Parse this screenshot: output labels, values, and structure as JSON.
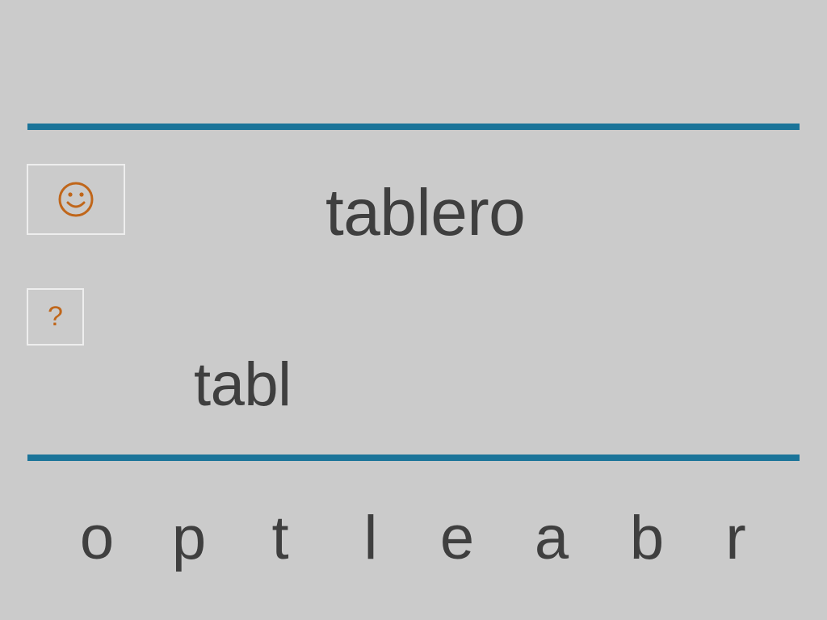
{
  "target_word": "tablero",
  "answer_text": "tabl",
  "hint_label": "?",
  "feedback_icon": "smiley-face-icon",
  "letters": [
    "o",
    "p",
    "t",
    "l",
    "e",
    "a",
    "b",
    "r"
  ],
  "colors": {
    "background": "#cbcbcb",
    "rule": "#1b7499",
    "text": "#3f3f3f",
    "accent": "#c0661a",
    "box_border": "#eeeeee"
  }
}
